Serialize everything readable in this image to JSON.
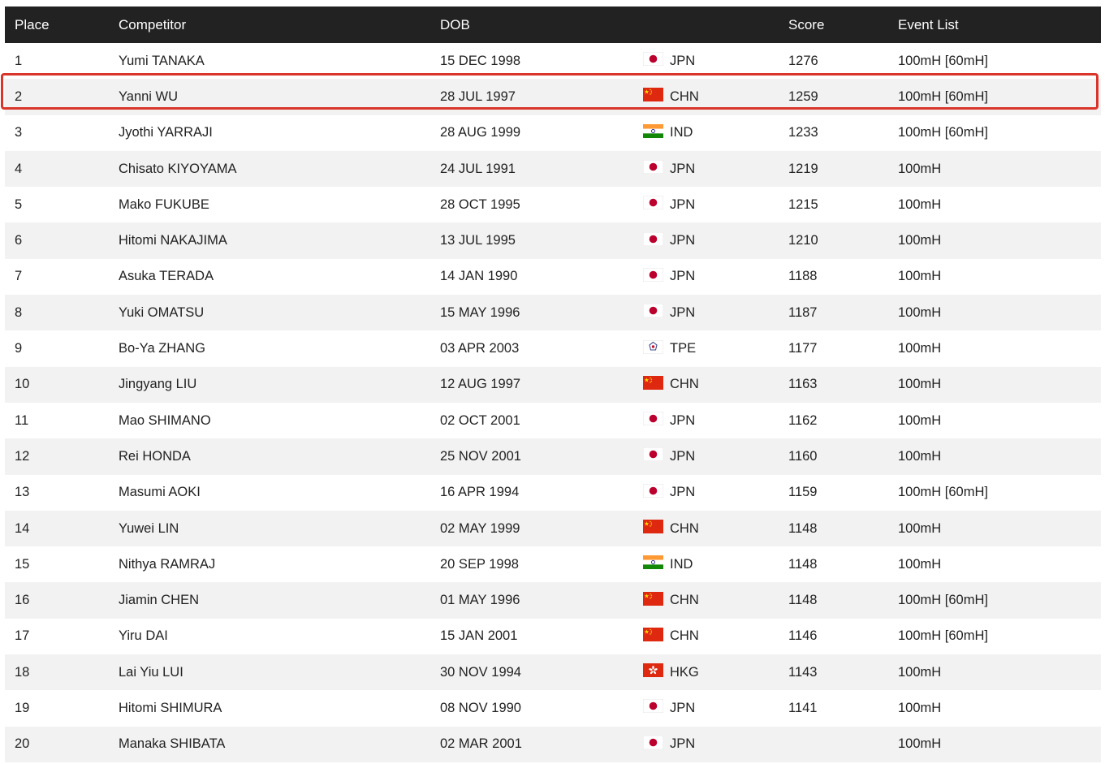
{
  "table": {
    "headers": {
      "place": "Place",
      "competitor": "Competitor",
      "dob": "DOB",
      "score": "Score",
      "events": "Event List"
    },
    "rows": [
      {
        "place": "1",
        "name": "Yumi TANAKA",
        "dob": "15 DEC 1998",
        "country": "JPN",
        "flag": "japan-flag-icon",
        "score": "1276",
        "events": "100mH [60mH]"
      },
      {
        "place": "2",
        "name": "Yanni WU",
        "dob": "28 JUL 1997",
        "country": "CHN",
        "flag": "china-flag-icon",
        "score": "1259",
        "events": "100mH [60mH]"
      },
      {
        "place": "3",
        "name": "Jyothi YARRAJI",
        "dob": "28 AUG 1999",
        "country": "IND",
        "flag": "india-flag-icon",
        "score": "1233",
        "events": "100mH [60mH]"
      },
      {
        "place": "4",
        "name": "Chisato KIYOYAMA",
        "dob": "24 JUL 1991",
        "country": "JPN",
        "flag": "japan-flag-icon",
        "score": "1219",
        "events": "100mH"
      },
      {
        "place": "5",
        "name": "Mako FUKUBE",
        "dob": "28 OCT 1995",
        "country": "JPN",
        "flag": "japan-flag-icon",
        "score": "1215",
        "events": "100mH"
      },
      {
        "place": "6",
        "name": "Hitomi NAKAJIMA",
        "dob": "13 JUL 1995",
        "country": "JPN",
        "flag": "japan-flag-icon",
        "score": "1210",
        "events": "100mH"
      },
      {
        "place": "7",
        "name": "Asuka TERADA",
        "dob": "14 JAN 1990",
        "country": "JPN",
        "flag": "japan-flag-icon",
        "score": "1188",
        "events": "100mH"
      },
      {
        "place": "8",
        "name": "Yuki OMATSU",
        "dob": "15 MAY 1996",
        "country": "JPN",
        "flag": "japan-flag-icon",
        "score": "1187",
        "events": "100mH"
      },
      {
        "place": "9",
        "name": "Bo-Ya ZHANG",
        "dob": "03 APR 2003",
        "country": "TPE",
        "flag": "chinese-taipei-flag-icon",
        "score": "1177",
        "events": "100mH"
      },
      {
        "place": "10",
        "name": "Jingyang LIU",
        "dob": "12 AUG 1997",
        "country": "CHN",
        "flag": "china-flag-icon",
        "score": "1163",
        "events": "100mH"
      },
      {
        "place": "11",
        "name": "Mao SHIMANO",
        "dob": "02 OCT 2001",
        "country": "JPN",
        "flag": "japan-flag-icon",
        "score": "1162",
        "events": "100mH"
      },
      {
        "place": "12",
        "name": "Rei HONDA",
        "dob": "25 NOV 2001",
        "country": "JPN",
        "flag": "japan-flag-icon",
        "score": "1160",
        "events": "100mH"
      },
      {
        "place": "13",
        "name": "Masumi AOKI",
        "dob": "16 APR 1994",
        "country": "JPN",
        "flag": "japan-flag-icon",
        "score": "1159",
        "events": "100mH [60mH]"
      },
      {
        "place": "14",
        "name": "Yuwei LIN",
        "dob": "02 MAY 1999",
        "country": "CHN",
        "flag": "china-flag-icon",
        "score": "1148",
        "events": "100mH"
      },
      {
        "place": "15",
        "name": "Nithya RAMRAJ",
        "dob": "20 SEP 1998",
        "country": "IND",
        "flag": "india-flag-icon",
        "score": "1148",
        "events": "100mH"
      },
      {
        "place": "16",
        "name": "Jiamin CHEN",
        "dob": "01 MAY 1996",
        "country": "CHN",
        "flag": "china-flag-icon",
        "score": "1148",
        "events": "100mH [60mH]"
      },
      {
        "place": "17",
        "name": "Yiru DAI",
        "dob": "15 JAN 2001",
        "country": "CHN",
        "flag": "china-flag-icon",
        "score": "1146",
        "events": "100mH [60mH]"
      },
      {
        "place": "18",
        "name": "Lai Yiu LUI",
        "dob": "30 NOV 1994",
        "country": "HKG",
        "flag": "hong-kong-flag-icon",
        "score": "1143",
        "events": "100mH"
      },
      {
        "place": "19",
        "name": "Hitomi SHIMURA",
        "dob": "08 NOV 1990",
        "country": "JPN",
        "flag": "japan-flag-icon",
        "score": "1141",
        "events": "100mH"
      },
      {
        "place": "20",
        "name": "Manaka SHIBATA",
        "dob": "02 MAR 2001",
        "country": "JPN",
        "flag": "japan-flag-icon",
        "score": "",
        "events": "100mH"
      }
    ],
    "highlighted_place": "2"
  },
  "colors": {
    "header_bg": "#222222",
    "header_text": "#ffffff",
    "row_alt": "#f2f2f2",
    "highlight": "#d9352b"
  }
}
